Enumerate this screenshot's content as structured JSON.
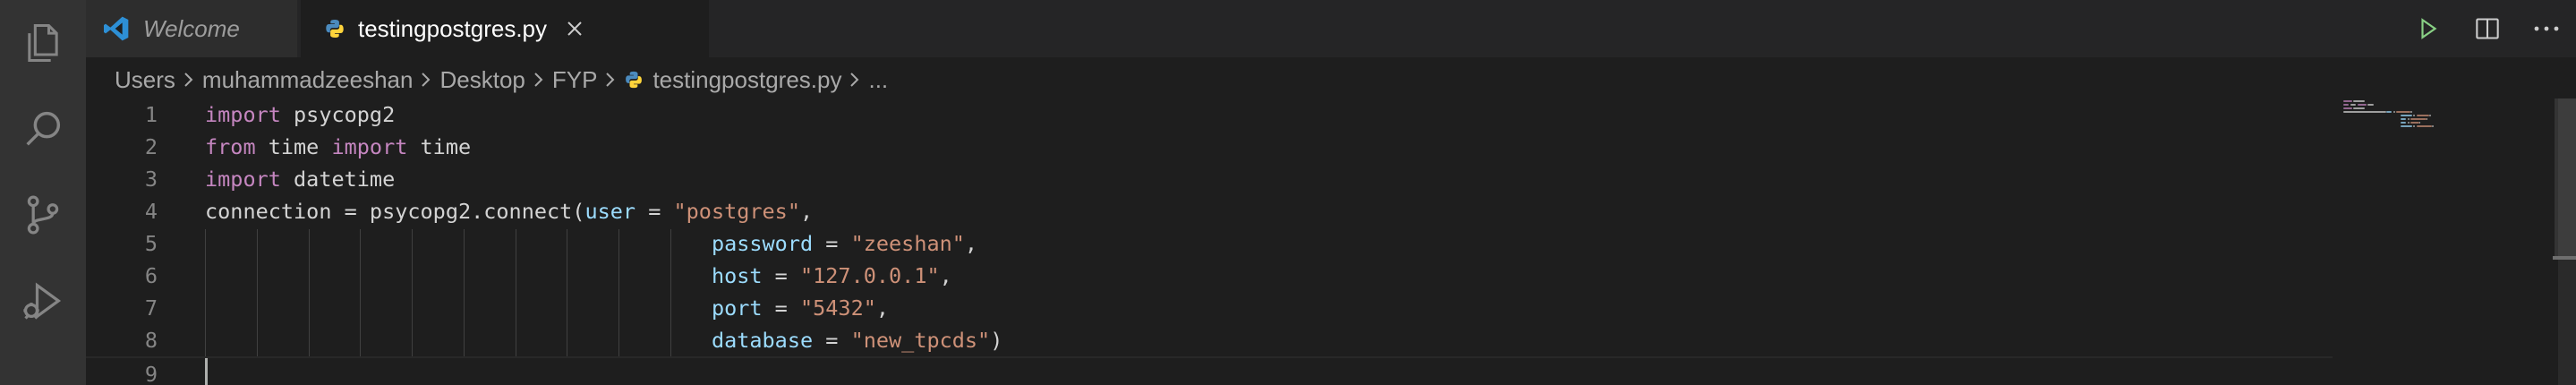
{
  "tabs": [
    {
      "label": "Welcome",
      "icon": "vscode-logo-icon",
      "active": false
    },
    {
      "label": "testingpostgres.py",
      "icon": "python-file-icon",
      "active": true
    }
  ],
  "breadcrumb": {
    "parts": [
      "Users",
      "muhammadzeeshan",
      "Desktop",
      "FYP",
      "testingpostgres.py",
      "..."
    ]
  },
  "editor": {
    "line_numbers": [
      "1",
      "2",
      "3",
      "4",
      "5",
      "6",
      "7",
      "8",
      "9"
    ],
    "lines": [
      {
        "tokens": [
          {
            "t": "import",
            "c": "kw"
          },
          {
            "t": " psycopg2",
            "c": "pl"
          }
        ]
      },
      {
        "tokens": [
          {
            "t": "from",
            "c": "kw"
          },
          {
            "t": " time ",
            "c": "pl"
          },
          {
            "t": "import",
            "c": "kw"
          },
          {
            "t": " time",
            "c": "pl"
          }
        ]
      },
      {
        "tokens": [
          {
            "t": "import",
            "c": "kw"
          },
          {
            "t": " datetime",
            "c": "pl"
          }
        ]
      },
      {
        "tokens": [
          {
            "t": "connection = psycopg2.connect(",
            "c": "pl"
          },
          {
            "t": "user",
            "c": "pm"
          },
          {
            "t": " = ",
            "c": "pl"
          },
          {
            "t": "\"postgres\"",
            "c": "st"
          },
          {
            "t": ",",
            "c": "pl"
          }
        ]
      },
      {
        "tokens": [
          {
            "t": "                                        ",
            "c": "pl"
          },
          {
            "t": "password",
            "c": "pm"
          },
          {
            "t": " = ",
            "c": "pl"
          },
          {
            "t": "\"zeeshan\"",
            "c": "st"
          },
          {
            "t": ",",
            "c": "pl"
          }
        ]
      },
      {
        "tokens": [
          {
            "t": "                                        ",
            "c": "pl"
          },
          {
            "t": "host",
            "c": "pm"
          },
          {
            "t": " = ",
            "c": "pl"
          },
          {
            "t": "\"127.0.0.1\"",
            "c": "st"
          },
          {
            "t": ",",
            "c": "pl"
          }
        ]
      },
      {
        "tokens": [
          {
            "t": "                                        ",
            "c": "pl"
          },
          {
            "t": "port",
            "c": "pm"
          },
          {
            "t": " = ",
            "c": "pl"
          },
          {
            "t": "\"5432\"",
            "c": "st"
          },
          {
            "t": ",",
            "c": "pl"
          }
        ]
      },
      {
        "tokens": [
          {
            "t": "                                        ",
            "c": "pl"
          },
          {
            "t": "database",
            "c": "pm"
          },
          {
            "t": " = ",
            "c": "pl"
          },
          {
            "t": "\"new_tpcds\"",
            "c": "st"
          },
          {
            "t": ")",
            "c": "pl"
          }
        ]
      },
      {
        "tokens": []
      }
    ],
    "current_line": 9
  },
  "activity_bar": [
    "explorer-icon",
    "search-icon",
    "source-control-icon",
    "run-debug-icon"
  ],
  "editor_actions": [
    "run-icon",
    "split-editor-icon",
    "more-actions-icon"
  ],
  "colors": {
    "keyword": "#c586c0",
    "plain": "#d4d4d4",
    "param": "#9cdcfe",
    "string": "#ce9178",
    "run_green": "#89d185",
    "vscode_blue": "#2d8fd5",
    "python_blue": "#4b8bbe",
    "python_yellow": "#ffd43b"
  }
}
